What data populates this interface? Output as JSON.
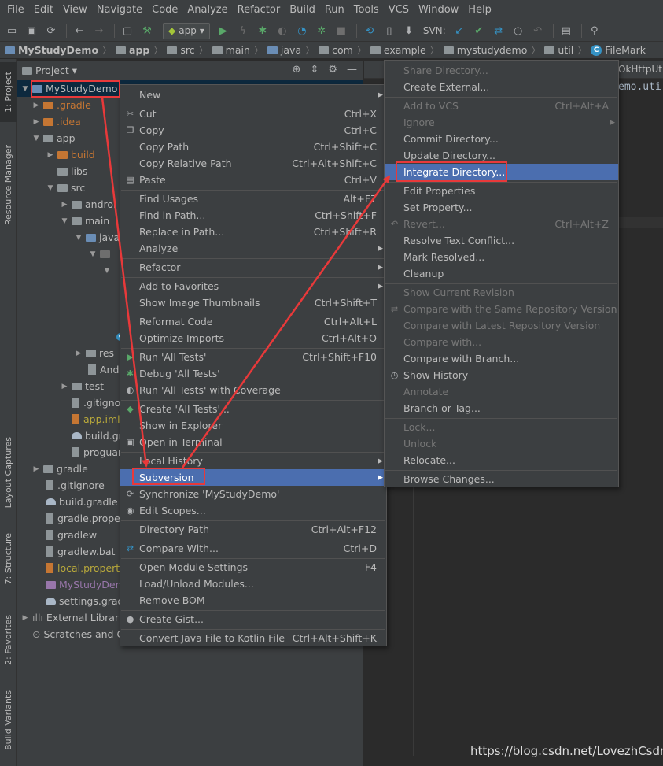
{
  "menubar": [
    "File",
    "Edit",
    "View",
    "Navigate",
    "Code",
    "Analyze",
    "Refactor",
    "Build",
    "Run",
    "Tools",
    "VCS",
    "Window",
    "Help"
  ],
  "toolbar": {
    "run_config": "app",
    "svn_label": "SVN:"
  },
  "breadcrumb": [
    "MyStudyDemo",
    "app",
    "src",
    "main",
    "java",
    "com",
    "example",
    "mystudydemo",
    "util",
    "FileMark"
  ],
  "left_tabs": [
    "1: Project",
    "Resource Manager",
    "Layout Captures",
    "7: Structure",
    "2: Favorites",
    "Build Variants"
  ],
  "project_panel": {
    "title": "Project"
  },
  "tree": [
    {
      "label": "MyStudyDemo"
    },
    {
      "label": ".gradle"
    },
    {
      "label": ".idea"
    },
    {
      "label": "app"
    },
    {
      "label": "build"
    },
    {
      "label": "libs"
    },
    {
      "label": "src"
    },
    {
      "label": "androi"
    },
    {
      "label": "main"
    },
    {
      "label": "java"
    },
    {
      "label": "res"
    },
    {
      "label": "And"
    },
    {
      "label": "test"
    },
    {
      "label": ".gitignore"
    },
    {
      "label": "app.iml"
    },
    {
      "label": "build.grad"
    },
    {
      "label": "proguard"
    },
    {
      "label": "gradle"
    },
    {
      "label": ".gitignore"
    },
    {
      "label": "build.gradle"
    },
    {
      "label": "gradle.prope"
    },
    {
      "label": "gradlew"
    },
    {
      "label": "gradlew.bat"
    },
    {
      "label": "local.propert"
    },
    {
      "label": "MyStudyDem"
    },
    {
      "label": "settings.grad"
    },
    {
      "label": "External Librarie"
    },
    {
      "label": "Scratches and C"
    }
  ],
  "context_menu": [
    {
      "label": "New",
      "shortcut": "",
      "submenu": true
    },
    {
      "label": "Cut",
      "shortcut": "Ctrl+X"
    },
    {
      "label": "Copy",
      "shortcut": "Ctrl+C"
    },
    {
      "label": "Copy Path",
      "shortcut": "Ctrl+Shift+C"
    },
    {
      "label": "Copy Relative Path",
      "shortcut": "Ctrl+Alt+Shift+C"
    },
    {
      "label": "Paste",
      "shortcut": "Ctrl+V"
    },
    {
      "label": "Find Usages",
      "shortcut": "Alt+F7"
    },
    {
      "label": "Find in Path...",
      "shortcut": "Ctrl+Shift+F"
    },
    {
      "label": "Replace in Path...",
      "shortcut": "Ctrl+Shift+R"
    },
    {
      "label": "Analyze",
      "shortcut": "",
      "submenu": true
    },
    {
      "label": "Refactor",
      "shortcut": "",
      "submenu": true
    },
    {
      "label": "Add to Favorites",
      "shortcut": "",
      "submenu": true
    },
    {
      "label": "Show Image Thumbnails",
      "shortcut": "Ctrl+Shift+T"
    },
    {
      "label": "Reformat Code",
      "shortcut": "Ctrl+Alt+L"
    },
    {
      "label": "Optimize Imports",
      "shortcut": "Ctrl+Alt+O"
    },
    {
      "label": "Run 'All Tests'",
      "shortcut": "Ctrl+Shift+F10"
    },
    {
      "label": "Debug 'All Tests'",
      "shortcut": ""
    },
    {
      "label": "Run 'All Tests' with Coverage",
      "shortcut": ""
    },
    {
      "label": "Create 'All Tests'...",
      "shortcut": ""
    },
    {
      "label": "Show in Explorer",
      "shortcut": ""
    },
    {
      "label": "Open in Terminal",
      "shortcut": ""
    },
    {
      "label": "Local History",
      "shortcut": "",
      "submenu": true
    },
    {
      "label": "Subversion",
      "shortcut": "",
      "submenu": true
    },
    {
      "label": "Synchronize 'MyStudyDemo'",
      "shortcut": ""
    },
    {
      "label": "Edit Scopes...",
      "shortcut": ""
    },
    {
      "label": "Directory Path",
      "shortcut": "Ctrl+Alt+F12"
    },
    {
      "label": "Compare With...",
      "shortcut": "Ctrl+D"
    },
    {
      "label": "Open Module Settings",
      "shortcut": "F4"
    },
    {
      "label": "Load/Unload Modules...",
      "shortcut": ""
    },
    {
      "label": "Remove BOM",
      "shortcut": ""
    },
    {
      "label": "Create Gist...",
      "shortcut": ""
    },
    {
      "label": "Convert Java File to Kotlin File",
      "shortcut": "Ctrl+Alt+Shift+K"
    }
  ],
  "svn_menu": [
    {
      "label": "Share Directory...",
      "shortcut": "",
      "disabled": true
    },
    {
      "label": "Create External...",
      "shortcut": ""
    },
    {
      "label": "Add to VCS",
      "shortcut": "Ctrl+Alt+A",
      "disabled": true
    },
    {
      "label": "Ignore",
      "shortcut": "",
      "disabled": true,
      "submenu": true
    },
    {
      "label": "Commit Directory...",
      "shortcut": ""
    },
    {
      "label": "Update Directory...",
      "shortcut": ""
    },
    {
      "label": "Integrate Directory...",
      "shortcut": ""
    },
    {
      "label": "Edit Properties",
      "shortcut": ""
    },
    {
      "label": "Set Property...",
      "shortcut": ""
    },
    {
      "label": "Revert...",
      "shortcut": "Ctrl+Alt+Z",
      "disabled": true
    },
    {
      "label": "Resolve Text Conflict...",
      "shortcut": ""
    },
    {
      "label": "Mark Resolved...",
      "shortcut": ""
    },
    {
      "label": "Cleanup",
      "shortcut": ""
    },
    {
      "label": "Show Current Revision",
      "shortcut": "",
      "disabled": true
    },
    {
      "label": "Compare with the Same Repository Version",
      "shortcut": "",
      "disabled": true
    },
    {
      "label": "Compare with Latest Repository Version",
      "shortcut": "",
      "disabled": true
    },
    {
      "label": "Compare with...",
      "shortcut": "",
      "disabled": true
    },
    {
      "label": "Compare with Branch...",
      "shortcut": ""
    },
    {
      "label": "Show History",
      "shortcut": ""
    },
    {
      "label": "Annotate",
      "shortcut": "",
      "disabled": true
    },
    {
      "label": "Branch or Tag...",
      "shortcut": ""
    },
    {
      "label": "Lock...",
      "shortcut": "",
      "disabled": true
    },
    {
      "label": "Unlock",
      "shortcut": "",
      "disabled": true
    },
    {
      "label": "Relocate...",
      "shortcut": ""
    },
    {
      "label": "Browse Changes...",
      "shortcut": ""
    }
  ],
  "editor": {
    "tab": "OkHttpUtil.",
    "code_line": "emo.uti"
  },
  "watermark": "https://blog.csdn.net/LovezhCsdn",
  "colors": {
    "highlight": "#4b6eaf",
    "annotation": "#e8393a",
    "background": "#3c3f41"
  }
}
